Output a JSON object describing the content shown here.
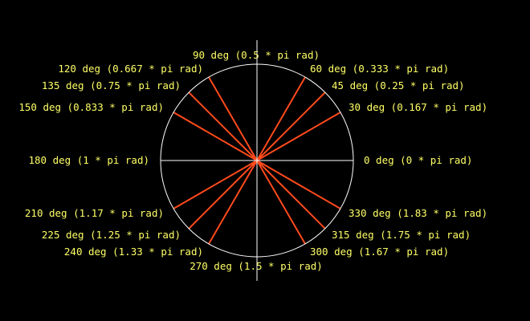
{
  "colors": {
    "background": "#000000",
    "axis": "#ffffff",
    "circle": "#ffffff",
    "ray": "#ff4a1c",
    "label": "#ffff66"
  },
  "angles": [
    {
      "deg": 0,
      "label": "0 deg (0 * pi rad)"
    },
    {
      "deg": 30,
      "label": "30 deg (0.167 * pi rad)"
    },
    {
      "deg": 45,
      "label": "45 deg (0.25 * pi rad)"
    },
    {
      "deg": 60,
      "label": "60 deg (0.333 * pi rad)"
    },
    {
      "deg": 90,
      "label": "90 deg (0.5 * pi rad)"
    },
    {
      "deg": 120,
      "label": "120 deg (0.667 * pi rad)"
    },
    {
      "deg": 135,
      "label": "135 deg (0.75 * pi rad)"
    },
    {
      "deg": 150,
      "label": "150 deg (0.833 * pi rad)"
    },
    {
      "deg": 180,
      "label": "180 deg (1 * pi rad)"
    },
    {
      "deg": 210,
      "label": "210 deg (1.17 * pi rad)"
    },
    {
      "deg": 225,
      "label": "225 deg (1.25 * pi rad)"
    },
    {
      "deg": 240,
      "label": "240 deg (1.33 * pi rad)"
    },
    {
      "deg": 270,
      "label": "270 deg (1.5 * pi rad)"
    },
    {
      "deg": 300,
      "label": "300 deg (1.67 * pi rad)"
    },
    {
      "deg": 315,
      "label": "315 deg (1.75 * pi rad)"
    },
    {
      "deg": 330,
      "label": "330 deg (1.83 * pi rad)"
    }
  ]
}
